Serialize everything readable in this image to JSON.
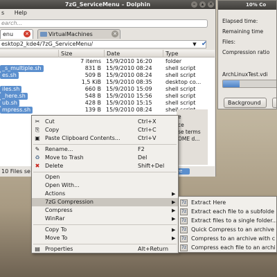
{
  "dolphin": {
    "title": "7zG_ServiceMenu – Dolphin",
    "menu": [
      "s",
      "Help"
    ],
    "search_placeholder": "earch...",
    "tabs": [
      {
        "label": "enu"
      },
      {
        "label": "VirtualMachines"
      }
    ],
    "path": "esktop2_kde4/7zG_ServiceMenu/",
    "columns": [
      "Size",
      "Date",
      "Type"
    ],
    "rows": [
      {
        "name": "",
        "size": "7 items",
        "date": "15/9/2010 16:20",
        "type": "folder",
        "selected": false
      },
      {
        "name": "_s_multiple.sh",
        "size": "831 B",
        "date": "15/9/2010 08:24",
        "type": "shell script",
        "selected": true
      },
      {
        "name": "es.sh",
        "size": "509 B",
        "date": "15/9/2010 08:24",
        "type": "shell script",
        "selected": true
      },
      {
        "name": "",
        "size": "1,5 KiB",
        "date": "15/9/2010 08:35",
        "type": "desktop co...",
        "selected": false
      },
      {
        "name": "iles.sh",
        "size": "660 B",
        "date": "15/9/2010 15:09",
        "type": "shell script",
        "selected": true
      },
      {
        "name": "_here.sh",
        "size": "548 B",
        "date": "15/9/2010 15:56",
        "type": "shell script",
        "selected": true
      },
      {
        "name": "ub.sh",
        "size": "428 B",
        "date": "15/9/2010 15:15",
        "type": "shell script",
        "selected": true
      },
      {
        "name": "mpress.sh",
        "size": "139 B",
        "date": "15/9/2010 08:24",
        "type": "shell script",
        "selected": true
      }
    ],
    "status": "10 Files se",
    "status_slider": "ee"
  },
  "progress": {
    "title": "10% Co",
    "elapsed_label": "Elapsed time:",
    "remaining_label": "Remaining time",
    "files_label": "Files:",
    "ratio_label": "Compression ratio",
    "archive_name": "ArchLinuxTest.vdi",
    "progress_percent": 10,
    "background_button": "Background",
    "colors": {
      "fill": "#4d82c5"
    }
  },
  "background_window": {
    "lines": [
      "e",
      "ce",
      "se terms",
      "OME d..."
    ]
  },
  "context_menu": {
    "items": [
      {
        "icon": "scissors-icon",
        "glyph": "✂",
        "label": "Cut",
        "shortcut": "Ctrl+X"
      },
      {
        "icon": "copy-icon",
        "glyph": "⎘",
        "label": "Copy",
        "shortcut": "Ctrl+C"
      },
      {
        "icon": "paste-icon",
        "glyph": "📋",
        "label": "Paste Clipboard Contents...",
        "shortcut": "Ctrl+V"
      },
      {
        "icon": "rename-icon",
        "glyph": "✎",
        "label": "Rename...",
        "shortcut": "F2"
      },
      {
        "icon": "trash-icon",
        "glyph": "🗑",
        "label": "Move to Trash",
        "shortcut": "Del"
      },
      {
        "icon": "delete-icon",
        "glyph": "✖",
        "label": "Delete",
        "shortcut": "Shift+Del"
      },
      {
        "label": "Open"
      },
      {
        "label": "Open With..."
      },
      {
        "label": "Actions"
      },
      {
        "label": "7zG Compression"
      },
      {
        "label": "Compress"
      },
      {
        "label": "WinRar"
      },
      {
        "label": "Copy To"
      },
      {
        "label": "Move To"
      },
      {
        "icon": "properties-icon",
        "glyph": "▤",
        "label": "Properties",
        "shortcut": "Alt+Return"
      }
    ]
  },
  "submenu": {
    "items": [
      {
        "label": "Extract Here"
      },
      {
        "label": "Extract each file to a subfolde"
      },
      {
        "label": "Extract files to a single folder..."
      },
      {
        "label": "Quick Compress to an archive"
      },
      {
        "label": "Compress to an archive with c"
      },
      {
        "label": "Compress each file to an archi"
      }
    ]
  }
}
